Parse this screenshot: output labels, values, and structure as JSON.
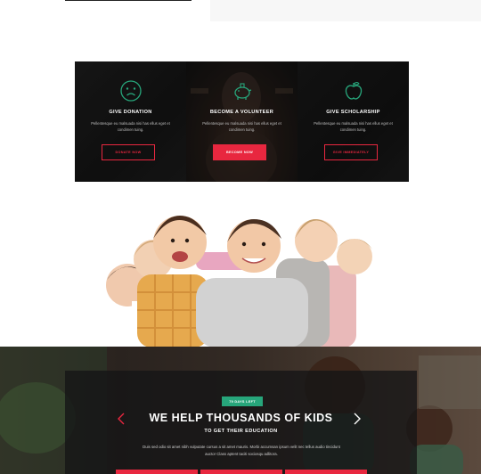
{
  "cards": [
    {
      "icon": "sad-face-icon",
      "title": "GIVE DONATION",
      "desc": "Pellentesque eu malsuada nisi has ellus eget et condimen tuing.",
      "button": "DONATE NOW"
    },
    {
      "icon": "piggy-bank-icon",
      "title": "BECOME A VOLUNTEER",
      "desc": "Pellentesque eu malsuada nisi has ellus eget et condimen tuing.",
      "button": "BECOME NOW"
    },
    {
      "icon": "apple-icon",
      "title": "GIVE SCHOLARSHIP",
      "desc": "Pellentesque eu malsuada nisi has ellus eget et condimen tuing.",
      "button": "GIVE IMMEDIATELY"
    }
  ],
  "hero": {
    "badge": "79 DAYS LEFT",
    "title": "WE HELP THOUSANDS OF KIDS",
    "subtitle": "TO GET THEIR EDUCATION",
    "description": "Duis sed odio sit amet nibh vulputate cursus a sit amet mauris. Morbi accumsan ipsum velit nec tellus audio tincidunt auctor Class aptent taciti sociosqu adlitora."
  },
  "colors": {
    "accent": "#e8273f",
    "icon_green": "#27a67b",
    "badge": "#27a67b"
  }
}
